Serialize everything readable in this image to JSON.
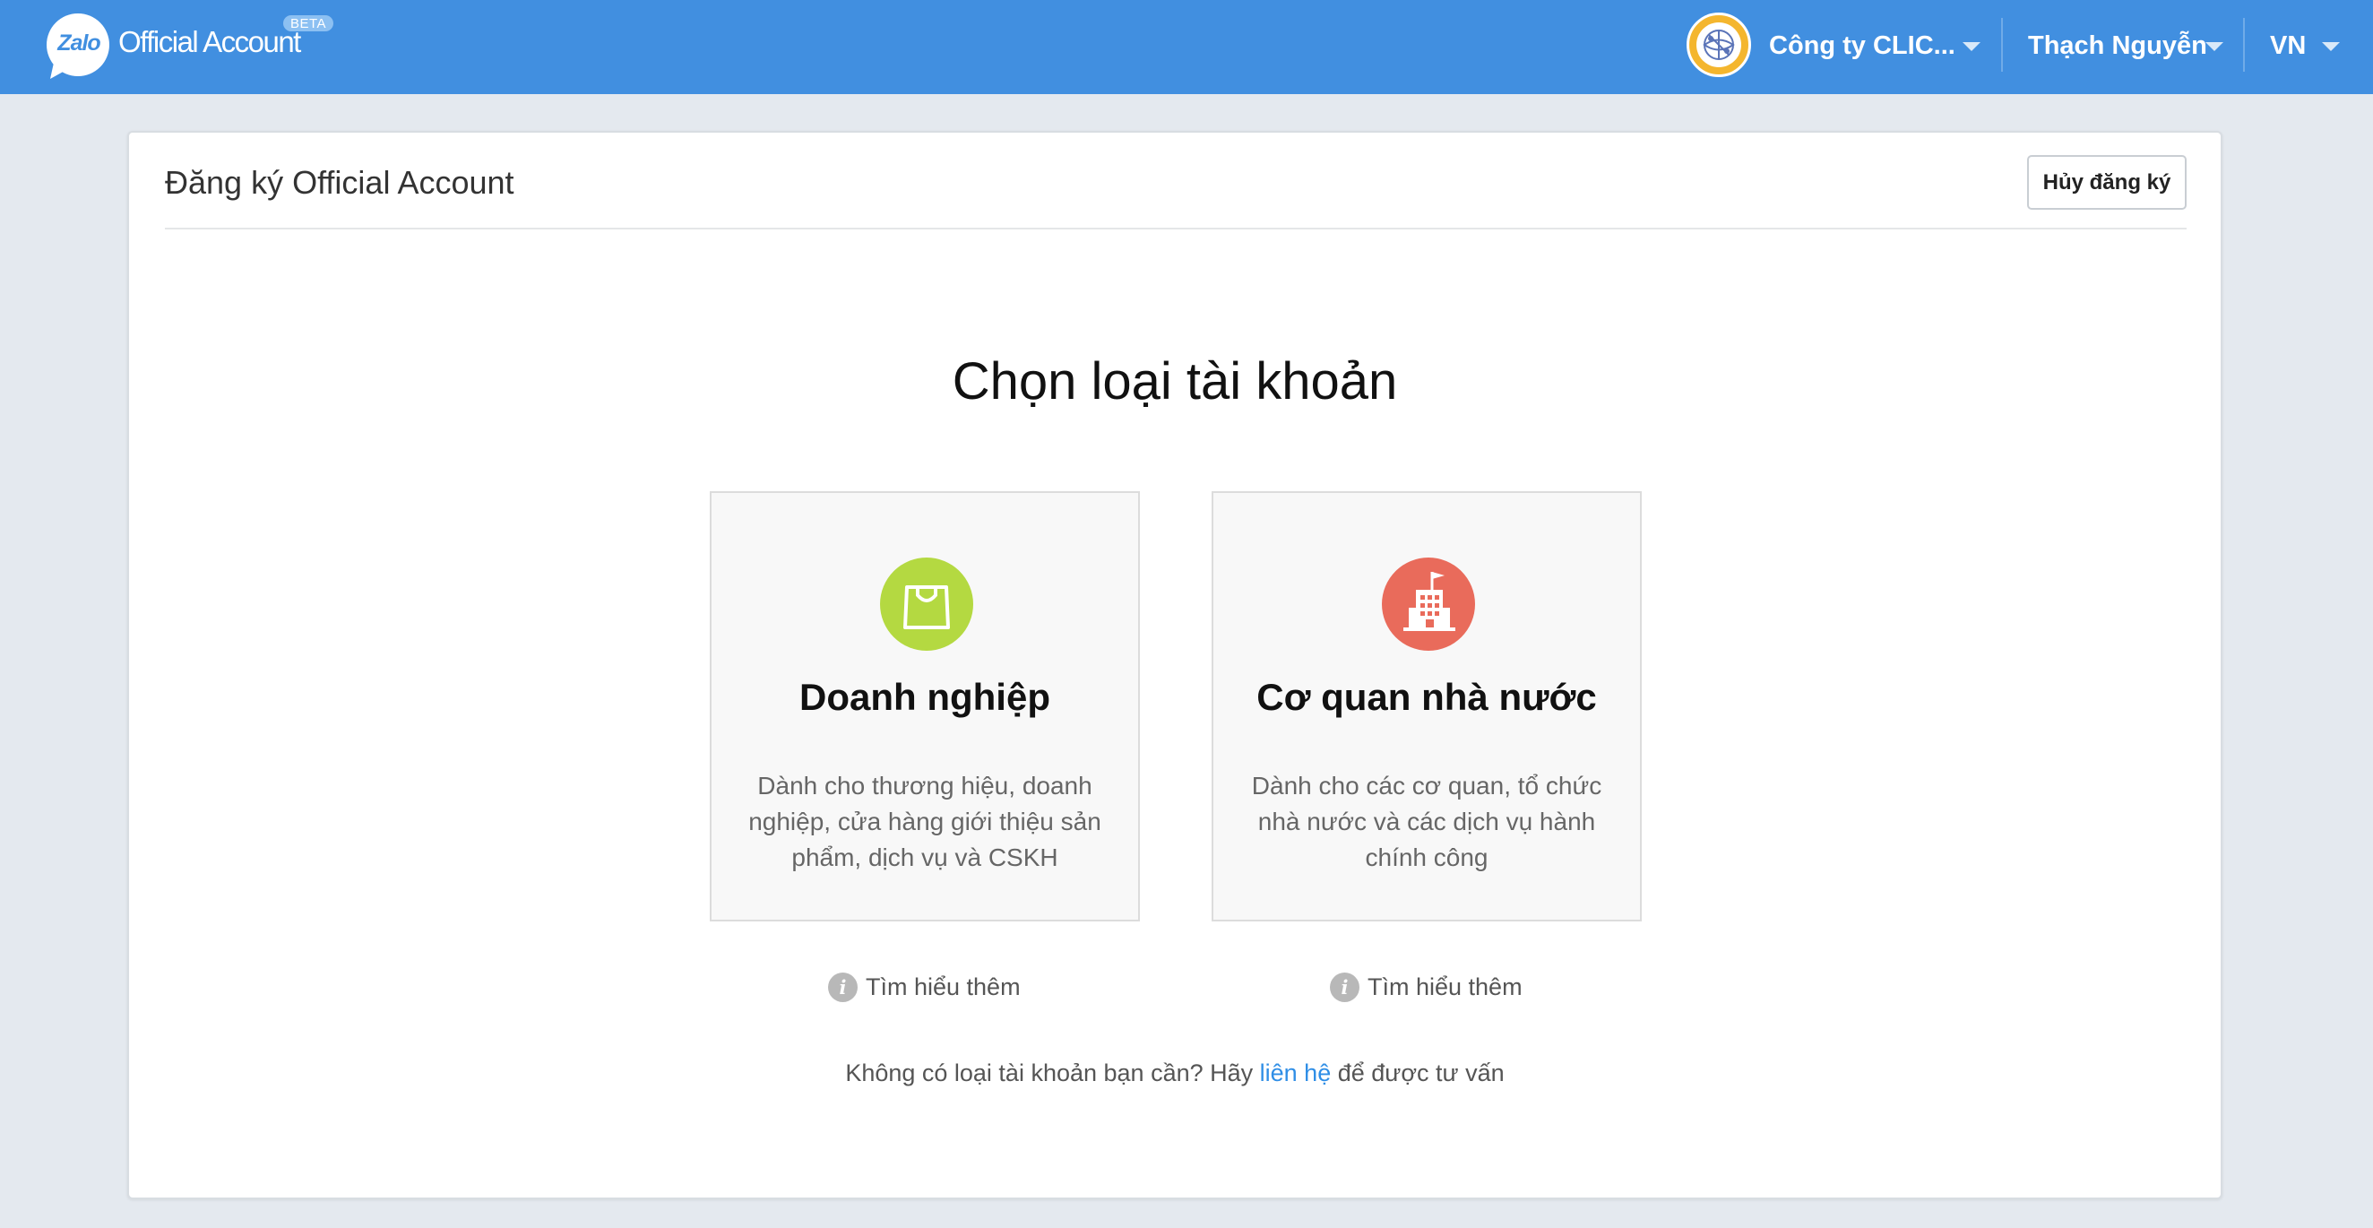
{
  "header": {
    "brand_logo_text": "Zalo",
    "brand_title": "Official Account",
    "beta_badge": "BETA",
    "company_name": "Công ty CLIC...",
    "user_name": "Thạch Nguyễn",
    "language": "VN",
    "bar_color": "#418fe0"
  },
  "card": {
    "title": "Đăng ký Official Account",
    "cancel_label": "Hủy đăng ký"
  },
  "main": {
    "heading": "Chọn loại tài khoản",
    "options": [
      {
        "title": "Doanh nghiệp",
        "description": "Dành cho thương hiệu, doanh nghiệp, cửa hàng giới thiệu sản phẩm, dịch vụ và CSKH",
        "icon": "shopping-bag-icon",
        "icon_color": "#b4d941",
        "learn_more": "Tìm hiểu thêm"
      },
      {
        "title": "Cơ quan nhà nước",
        "description": "Dành cho các cơ quan, tổ chức nhà nước và các dịch vụ hành chính công",
        "icon": "government-building-icon",
        "icon_color": "#e96b5b",
        "learn_more": "Tìm hiểu thêm"
      }
    ],
    "footer": {
      "before_link": "Không có loại tài khoản bạn cần? Hãy ",
      "link": "liên hệ",
      "after_link": " để được tư vấn",
      "link_color": "#2f8ee6"
    }
  }
}
